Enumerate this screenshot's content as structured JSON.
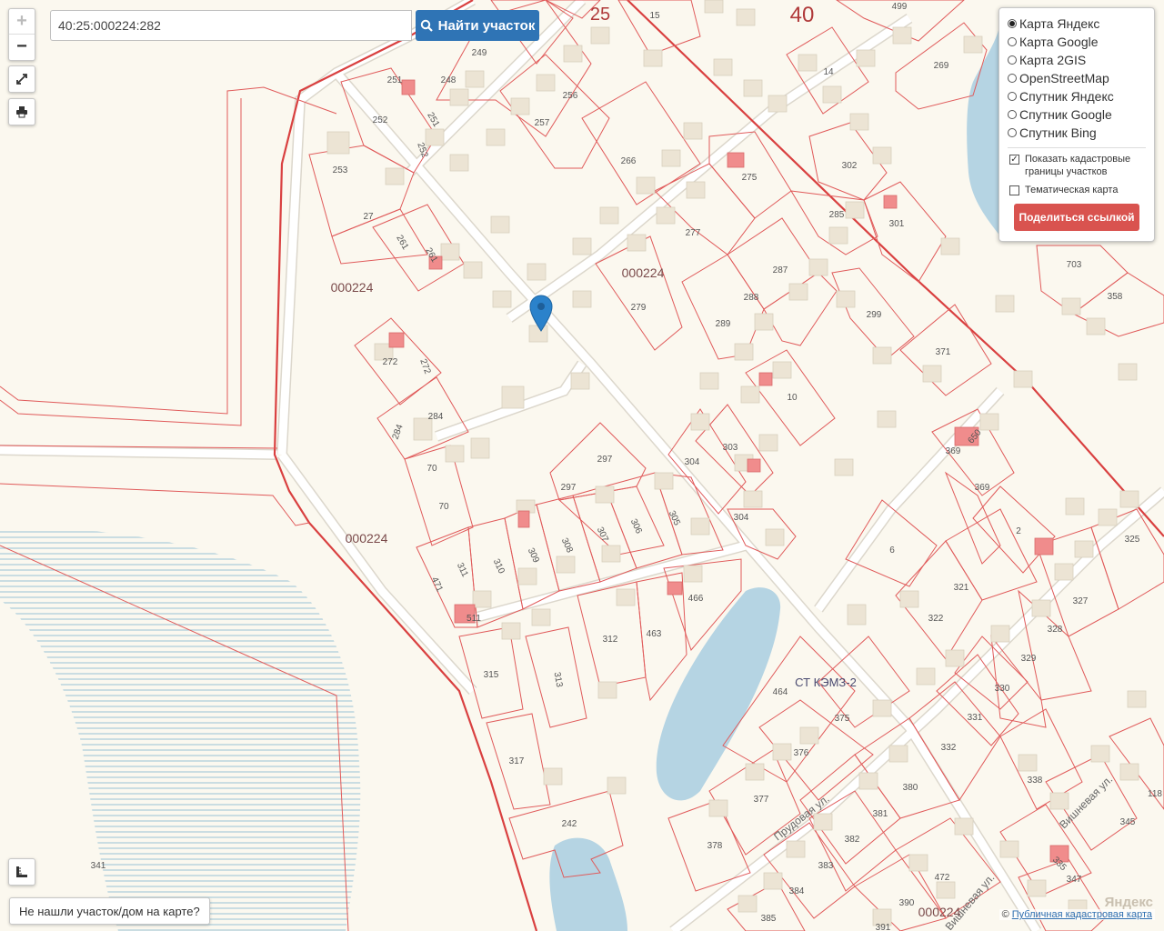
{
  "search": {
    "value": "40:25:000224:282",
    "button_label": "Найти участок"
  },
  "layers": {
    "options": [
      "Карта Яндекс",
      "Карта Google",
      "Карта 2GIS",
      "OpenStreetMap",
      "Спутник Яндекс",
      "Спутник Google",
      "Спутник Bing"
    ],
    "selected": "Карта Яндекс",
    "show_cadastral_label": "Показать кадастровые границы участков",
    "show_cadastral_checked": true,
    "thematic_label": "Тематическая карта",
    "thematic_checked": false,
    "share_label": "Поделиться ссылкой"
  },
  "not_found_label": "Не нашли участок/дом на карте?",
  "attribution": {
    "prefix": "©",
    "link": "Публичная кадастровая карта"
  },
  "yandex_logo": "Яндекс",
  "colors": {
    "parcel_border": "#e05a5a",
    "building": "#ece4d4",
    "building_highlight": "#f08c8c",
    "water": "#b5d4e3",
    "button_blue": "#2f74b5",
    "button_red": "#d9534f"
  },
  "map": {
    "quarter_labels": [
      {
        "text": "25"
      },
      {
        "text": "40"
      },
      {
        "text": "000224"
      },
      {
        "text": "000224"
      },
      {
        "text": "000224"
      },
      {
        "text": "000224"
      },
      {
        "text": "СТ КЭМЗ-2"
      }
    ],
    "streets": [
      "Прудовая ул.",
      "Вишневая ул.",
      "Вишневая ул."
    ],
    "parcel_numbers": [
      "249",
      "15",
      "499",
      "269",
      "251",
      "248",
      "251",
      "252",
      "252",
      "256",
      "257",
      "266",
      "14",
      "253",
      "27",
      "275",
      "302",
      "261",
      "261",
      "277",
      "287",
      "285",
      "301",
      "703",
      "358",
      "279",
      "288",
      "289",
      "299",
      "371",
      "272",
      "272",
      "10",
      "284",
      "284",
      "303",
      "304",
      "369",
      "650",
      "369",
      "297",
      "297",
      "70",
      "70",
      "304",
      "305",
      "306",
      "307",
      "308",
      "309",
      "310",
      "311",
      "471",
      "511",
      "6",
      "2",
      "325",
      "321",
      "322",
      "327",
      "328",
      "329",
      "466",
      "463",
      "312",
      "315",
      "313",
      "464",
      "375",
      "330",
      "331",
      "376",
      "332",
      "317",
      "377",
      "380",
      "338",
      "118",
      "242",
      "381",
      "345",
      "378",
      "382",
      "383",
      "472",
      "347",
      "335",
      "341",
      "384",
      "385",
      "390",
      "391",
      "000224"
    ]
  }
}
